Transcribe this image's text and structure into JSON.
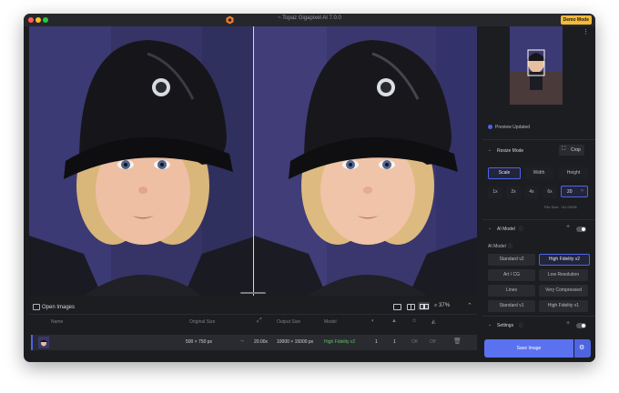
{
  "window": {
    "title": "~ Topaz Gigapixel AI 7.0.0",
    "demo_badge": "Demo Mode",
    "traffic_colors": [
      "#ff5f57",
      "#febc2e",
      "#28c840"
    ]
  },
  "viewer": {
    "zoom": "37%"
  },
  "bottom": {
    "open_images_label": "Open Images",
    "columns": {
      "name": "Name",
      "original_size": "Original Size",
      "output_size": "Output Size",
      "model": "Model"
    },
    "row": {
      "original_size": "500 × 750 px",
      "scale": "20.00x",
      "output_size": "10000 × 15000 px",
      "model": "High Fidelity v2",
      "val1": "1",
      "val2": "1",
      "val3": "Off",
      "val4": "Off"
    }
  },
  "sidebar": {
    "preview_status": "Preview Updated",
    "resize": {
      "title": "Resize Mode",
      "crop_label": "Crop",
      "modes": [
        "Scale",
        "Width",
        "Height"
      ],
      "selected_mode": "Scale",
      "scales": [
        "1x",
        "2x",
        "4x",
        "6x"
      ],
      "custom_value": "20",
      "file_size": "File Size: ~61.09GB"
    },
    "ai_model": {
      "title": "AI Model",
      "label": "AI Model",
      "models": [
        "Standard v2",
        "High Fidelity v2",
        "Art / CG",
        "Low Resolution",
        "Lines",
        "Very Compressed",
        "Standard v1",
        "High Fidelity v1"
      ],
      "selected": "High Fidelity v2"
    },
    "settings": {
      "title": "Settings"
    },
    "save_label": "Save Image"
  },
  "colors": {
    "accent": "#4c63e8",
    "save_button": "#5b72f0",
    "demo_badge": "#f4b93a",
    "model_green": "#5fc25f"
  }
}
